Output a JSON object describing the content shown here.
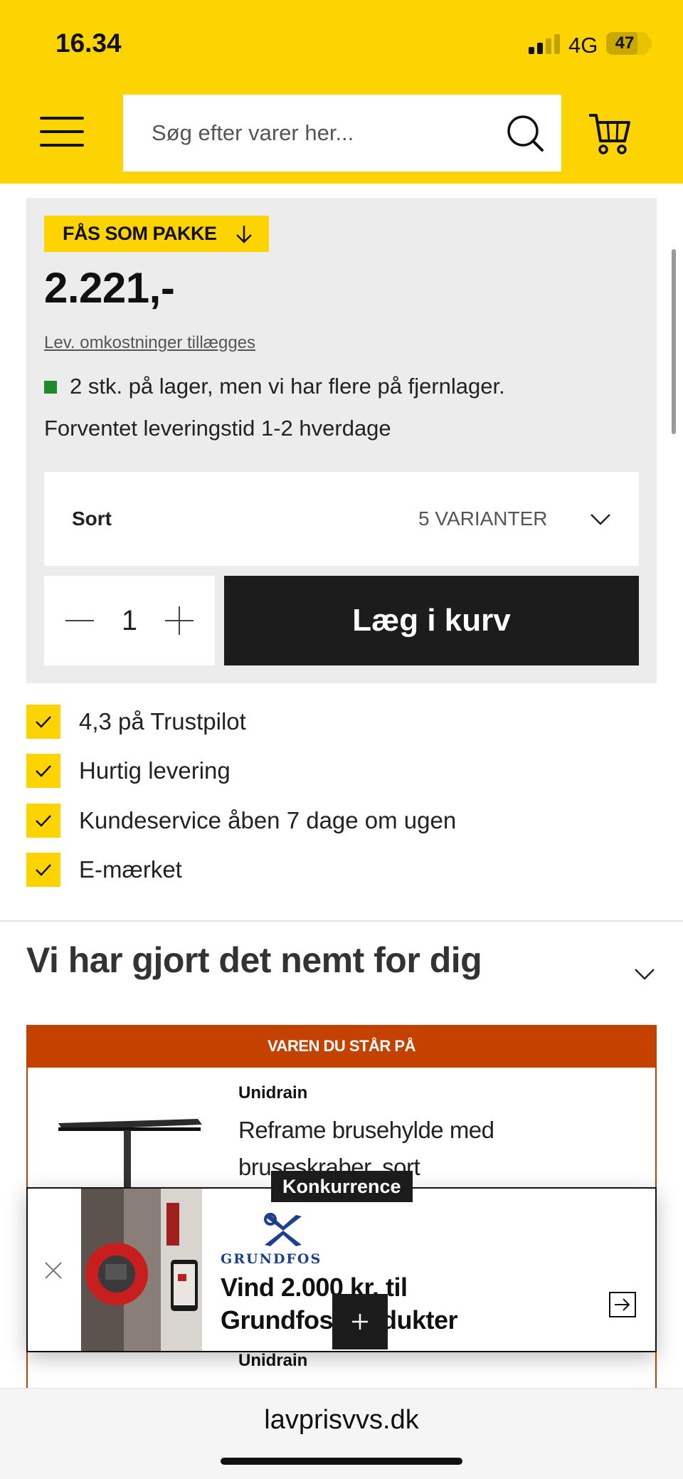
{
  "status_bar": {
    "time": "16.34",
    "network": "4G",
    "battery": "47"
  },
  "header": {
    "search_placeholder": "Søg efter varer her...",
    "icons": {
      "menu": "hamburger-menu-icon",
      "search": "search-icon",
      "cart": "cart-icon"
    }
  },
  "buybox": {
    "pack_label": "FÅS SOM PAKKE",
    "price": "2.221,-",
    "delivery_note": "Lev. omkostninger tillægges",
    "stock_text": "2 stk. på lager, men vi har flere på fjernlager.",
    "eta": "Forventet leveringstid 1-2 hverdage",
    "variant_color": "Sort",
    "variant_count": "5 VARIANTER",
    "quantity": "1",
    "add_to_cart": "Læg i kurv"
  },
  "usps": [
    "4,3 på Trustpilot",
    "Hurtig levering",
    "Kundeservice åben 7 dage om ugen",
    "E-mærket"
  ],
  "section": {
    "title": "Vi har gjort det nemt for dig"
  },
  "current_product": {
    "banner": "VAREN DU STÅR PÅ",
    "brand": "Unidrain",
    "name": "Reframe brusehylde med bruseskraber, sort",
    "next_brand": "Unidrain"
  },
  "promo": {
    "tag": "Konkurrence",
    "logo_text": "GRUNDFOS",
    "title": "Vind 2.000 kr. til Grundfos-produkter"
  },
  "browser": {
    "url": "lavprisvvs.dk"
  },
  "colors": {
    "brand_yellow": "#fdd400",
    "accent_orange": "#c44100",
    "stock_green": "#1e8a2e",
    "dark": "#1c1c1c"
  }
}
